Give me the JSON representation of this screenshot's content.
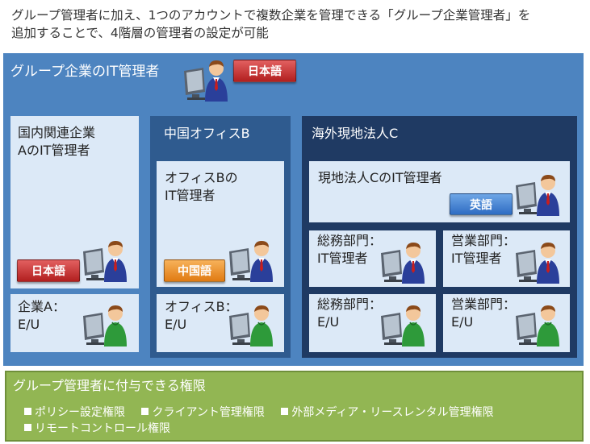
{
  "intro": {
    "line1": "グループ管理者に加え、1つのアカウントで複数企業を管理できる「グループ企業管理者」を",
    "line2": "追加することで、4階層の管理者の設定が可能"
  },
  "group": {
    "title": "グループ企業のIT管理者",
    "badge": "日本語"
  },
  "domestic": {
    "admin_line1": "国内関連企業",
    "admin_line2": "AのIT管理者",
    "badge": "日本語",
    "eu_line1": "企業A：",
    "eu_line2": "E/U"
  },
  "china": {
    "title": "中国オフィスB",
    "admin_line1": "オフィスBの",
    "admin_line2": "IT管理者",
    "badge": "中国語",
    "eu_line1": "オフィスB：",
    "eu_line2": "E/U"
  },
  "overseas": {
    "title": "海外現地法人C",
    "admin": "現地法人CのIT管理者",
    "badge": "英語",
    "dept1_line1": "総務部門：",
    "dept1_line2": "IT管理者",
    "dept2_line1": "営業部門：",
    "dept2_line2": "IT管理者",
    "eu1_line1": "総務部門：",
    "eu1_line2": "E/U",
    "eu2_line1": "営業部門：",
    "eu2_line2": "E/U"
  },
  "permissions": {
    "title": "グループ管理者に付与できる権限",
    "items": [
      "ポリシー設定権限",
      "クライアント管理権限",
      "外部メディア・リースレンタル管理権限",
      "リモートコントロール権限"
    ]
  },
  "icons": [
    "admin-person-icon",
    "enduser-person-icon"
  ],
  "colors": {
    "outer": "#4d84c0",
    "panel_light": "#dce9f7",
    "panel_dark": "#1f3a63",
    "permissions": "#92b653",
    "badge_red": "#c0302f",
    "badge_orange": "#ee8f25",
    "badge_blue": "#3a7bd0"
  }
}
